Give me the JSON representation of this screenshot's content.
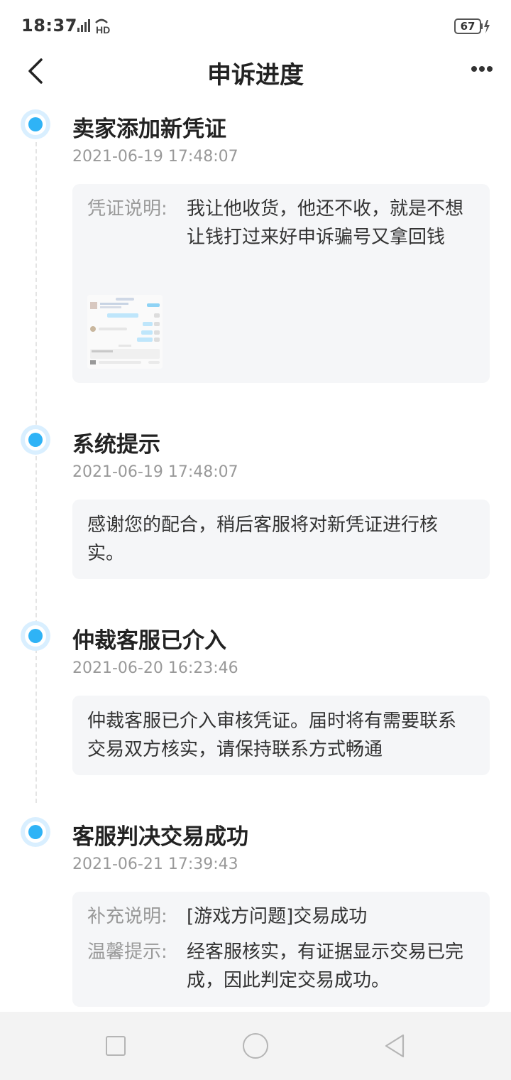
{
  "status_bar": {
    "time": "18:37",
    "network_icons": "signal-4g-hd-icon",
    "battery": "67"
  },
  "header": {
    "title": "申诉进度",
    "back_icon": "chevron-left-icon",
    "more_icon": "more-horizontal-icon"
  },
  "timeline": [
    {
      "title": "卖家添加新凭证",
      "time": "2021-06-19 17:48:07",
      "rows": [
        {
          "label": "凭证说明:",
          "value": "我让他收货，他还不收，就是不想让钱打过来好申诉骗号又拿回钱"
        }
      ],
      "attachment": "chat-screenshot-thumbnail"
    },
    {
      "title": "系统提示",
      "time": "2021-06-19 17:48:07",
      "text": "感谢您的配合，稍后客服将对新凭证进行核实。"
    },
    {
      "title": "仲裁客服已介入",
      "time": "2021-06-20 16:23:46",
      "text": "仲裁客服已介入审核凭证。届时将有需要联系交易双方核实，请保持联系方式畅通"
    },
    {
      "title": "客服判决交易成功",
      "time": "2021-06-21 17:39:43",
      "rows": [
        {
          "label": "补充说明:",
          "value": "[游戏方问题]交易成功"
        },
        {
          "label": "温馨提示:",
          "value": "经客服核实，有证据显示交易已完成，因此判定交易成功。"
        }
      ]
    }
  ],
  "colors": {
    "accent": "#2fb3f6",
    "card_bg": "#f5f6f8",
    "secondary_text": "#999999"
  },
  "bottom_nav": {
    "icons": [
      "recent-apps-square-icon",
      "home-circle-icon",
      "back-triangle-icon"
    ]
  }
}
